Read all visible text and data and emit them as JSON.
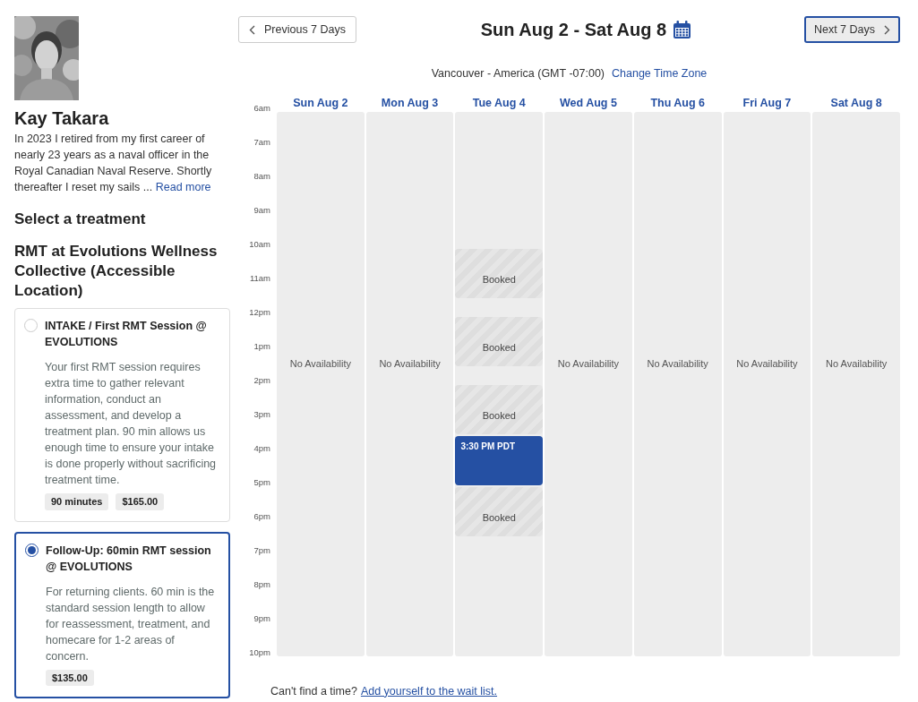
{
  "profile": {
    "name": "Kay Takara",
    "bio": "In 2023 I retired from my first career of nearly 23 years as a naval officer in the Royal Canadian Naval Reserve. Shortly thereafter I reset my sails ...",
    "read_more": "Read more"
  },
  "section_title": "Select a treatment",
  "location_title": "RMT at Evolutions Wellness Collective (Accessible Location)",
  "treatments": [
    {
      "name": "INTAKE / First RMT Session @ EVOLUTIONS",
      "description": "Your first RMT session requires extra time to gather relevant information, conduct an assessment, and develop a treatment plan. 90 min allows us enough time to ensure your intake is done properly without sacrificing treatment time.",
      "tags": [
        "90 minutes",
        "$165.00"
      ],
      "selected": false
    },
    {
      "name": "Follow-Up: 60min RMT session @ EVOLUTIONS",
      "description": "For returning clients. 60 min is the standard session length to allow for reassessment, treatment, and homecare for 1-2 areas of concern.",
      "tags": [
        "$135.00"
      ],
      "selected": true
    }
  ],
  "nav": {
    "previous": "Previous 7 Days",
    "title": "Sun Aug 2 - Sat Aug 8",
    "next": "Next 7 Days",
    "next_focused": true
  },
  "timezone": {
    "label": "Vancouver - America (GMT -07:00)",
    "link": "Change Time Zone"
  },
  "time_labels": [
    "6am",
    "7am",
    "8am",
    "9am",
    "10am",
    "11am",
    "12pm",
    "1pm",
    "2pm",
    "3pm",
    "4pm",
    "5pm",
    "6pm",
    "7pm",
    "8pm",
    "9pm",
    "10pm"
  ],
  "days": [
    {
      "label": "Sun Aug 2",
      "status": "No Availability"
    },
    {
      "label": "Mon Aug 3",
      "status": "No Availability"
    },
    {
      "label": "Tue Aug 4",
      "slots": [
        {
          "kind": "booked",
          "label": "Booked"
        },
        {
          "kind": "booked",
          "label": "Booked"
        },
        {
          "kind": "booked",
          "label": "Booked"
        },
        {
          "kind": "available",
          "label": "3:30 PM PDT"
        },
        {
          "kind": "booked",
          "label": "Booked"
        }
      ]
    },
    {
      "label": "Wed Aug 5",
      "status": "No Availability"
    },
    {
      "label": "Thu Aug 6",
      "status": "No Availability"
    },
    {
      "label": "Fri Aug 7",
      "status": "No Availability"
    },
    {
      "label": "Sat Aug 8",
      "status": "No Availability"
    }
  ],
  "footer": {
    "text": "Can't find a time?",
    "link": "Add yourself to the wait list."
  }
}
